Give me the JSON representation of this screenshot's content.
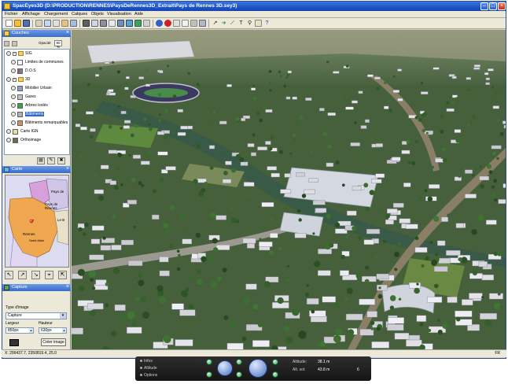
{
  "window": {
    "title": "SpacEyes3D (D:\\PRODUCTION\\RENNES\\PaysDeRennes3D_Extrait\\Pays de Rennes 3D.sey3)"
  },
  "menu": {
    "items": [
      "Fichier",
      "Affichage",
      "Chargement",
      "Calques",
      "Objets",
      "Visualisation",
      "Aide"
    ]
  },
  "layers_panel": {
    "title": "Couches",
    "opacity_label": "Opacité",
    "opacity_value": "90 %",
    "items": [
      {
        "label": "SIG",
        "type": "folder",
        "level": 0
      },
      {
        "label": "Limites de communes",
        "type": "layer",
        "level": 1
      },
      {
        "label": "D.O.S",
        "type": "layer",
        "level": 1
      },
      {
        "label": "3D",
        "type": "folder",
        "level": 0
      },
      {
        "label": "Mobilier Urbain",
        "type": "layer",
        "level": 1
      },
      {
        "label": "Gares",
        "type": "layer",
        "level": 1
      },
      {
        "label": "Arbres isolés",
        "type": "layer",
        "level": 1
      },
      {
        "label": "Bâtiments",
        "type": "layer",
        "level": 1,
        "selected": true
      },
      {
        "label": "Bâtiments remarquables",
        "type": "layer",
        "level": 1
      },
      {
        "label": "Carte IGN",
        "type": "layer",
        "level": 0
      },
      {
        "label": "Orthoimage",
        "type": "layer",
        "level": 0
      }
    ]
  },
  "map_panel": {
    "title": "Carte",
    "labels": [
      "Pays de",
      "Pays de Rennes",
      "Le B",
      "Rennes",
      "Saint-Malo"
    ]
  },
  "capture_panel": {
    "title": "Capture",
    "type_label": "Type d'image",
    "type_value": "Capture",
    "width_label": "Largeur",
    "height_label": "Hauteur",
    "width_value": "850px",
    "height_value": "630px",
    "button_label": "Créer image"
  },
  "hud": {
    "options": [
      "Infos",
      "Altitude",
      "Options"
    ],
    "altitude_label": "Altitude:",
    "altitude_value": "38.1 m",
    "alt_sol_label": "Alt. sol:",
    "alt_sol_value": "43.8 m",
    "extra_value": "6"
  },
  "status": {
    "coordinates": "X: 299437.7, 2350819.4, 25.0",
    "projection": "FR"
  },
  "colors": {
    "title_bar": "#1c53c8",
    "selection": "#316ac5",
    "terrain": "#3e5a38"
  }
}
